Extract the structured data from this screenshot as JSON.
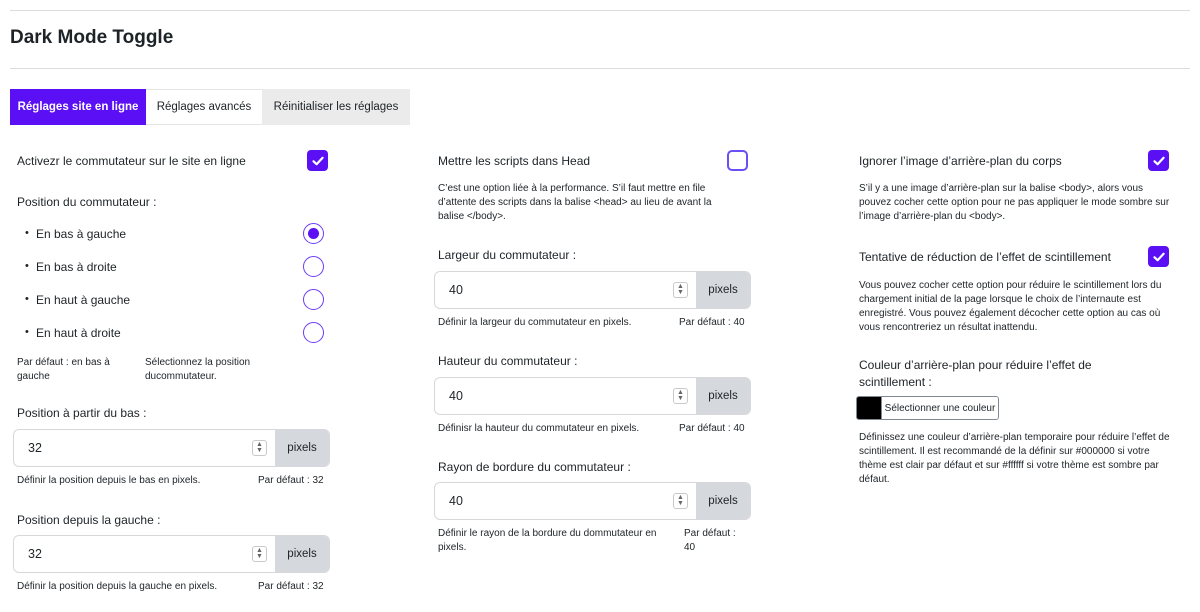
{
  "page_title": "Dark Mode Toggle",
  "tabs": [
    {
      "label": "Réglages site en ligne"
    },
    {
      "label": "Réglages avancés"
    },
    {
      "label": "Réinitialiser les réglages"
    }
  ],
  "accent_color": "#5a0ff5",
  "col1": {
    "enable_label": "Activezr le commutateur sur le site en ligne",
    "enable_checked": true,
    "position_label": "Position du commutateur :",
    "positions": [
      {
        "label": "En bas à gauche",
        "selected": true
      },
      {
        "label": "En bas à droite",
        "selected": false
      },
      {
        "label": "En haut à gauche",
        "selected": false
      },
      {
        "label": "En haut à droite",
        "selected": false
      }
    ],
    "position_default": "Par défaut : en bas à gauche",
    "position_help": "Sélectionnez la position ducommutateur.",
    "bottom_label": "Position à partir du bas :",
    "bottom_value": "32",
    "bottom_unit": "pixels",
    "bottom_help": "Définir la position depuis le bas en pixels.",
    "bottom_default": "Par défaut : 32",
    "left_label": "Position depuis la gauche :",
    "left_value": "32",
    "left_unit": "pixels",
    "left_help": "Définir la position depuis la gauche en pixels.",
    "left_default": "Par défaut : 32"
  },
  "col2": {
    "scripts_label": "Mettre les scripts dans Head",
    "scripts_checked": false,
    "scripts_help": "C’est une option liée à la performance. S’il faut mettre en file d’attente des scripts dans la balise <head> au lieu de avant la balise </body>.",
    "width_label": "Largeur du commutateur :",
    "width_value": "40",
    "width_unit": "pixels",
    "width_help": "Définir la largeur du commutateur en pixels.",
    "width_default": "Par défaut : 40",
    "height_label": "Hauteur du commutateur :",
    "height_value": "40",
    "height_unit": "pixels",
    "height_help": "Définisr la hauteur du commutateur en pixels.",
    "height_default": "Par défaut : 40",
    "radius_label": "Rayon de bordure du commutateur :",
    "radius_value": "40",
    "radius_unit": "pixels",
    "radius_help": "Définir le rayon de la bordure du dommutateur en pixels.",
    "radius_default": "Par défaut : 40"
  },
  "col3": {
    "ignore_bg_label": "Ignorer l’image d’arrière-plan du corps",
    "ignore_bg_checked": true,
    "ignore_bg_help": "S’il y a une image d’arrière-plan sur la balise <body>, alors vous pouvez cocher cette option pour ne pas appliquer le mode sombre sur l’image d’arrière-plan du <body>.",
    "flicker_label": "Tentative de réduction de l’effet de scintillement",
    "flicker_checked": true,
    "flicker_help": "Vous pouvez cocher cette option pour réduire le scintillement lors du chargement initial de la page lorsque le choix de l’internaute est enregistré. Vous pouvez également décocher cette option au cas où vous rencontreriez un résultat inattendu.",
    "bgcolor_label": "Couleur d’arrière-plan pour réduire l’effet de scintillement :",
    "bgcolor_value": "#000000",
    "bgcolor_button": "Sélectionner une couleur",
    "bgcolor_help": "Définissez une couleur d’arrière-plan temporaire pour réduire l’effet de scintillement. Il est recommandé de la définir sur #000000 si votre thème est clair par défaut et sur #ffffff si votre thème est sombre par défaut."
  }
}
